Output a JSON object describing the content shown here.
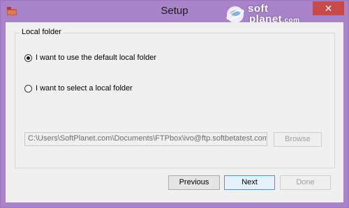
{
  "window": {
    "title": "Setup",
    "close_glyph": "✕"
  },
  "watermark": {
    "line1": "soft",
    "line2": "planet",
    "tld": ".com"
  },
  "local_folder": {
    "group_label": "Local folder",
    "options": [
      {
        "label": "I want to use the default local folder",
        "checked": true
      },
      {
        "label": "I want to select a local folder",
        "checked": false
      }
    ],
    "path_value": "C:\\Users\\SoftPlanet.com\\Documents\\FTPbox\\ivo@ftp.softbetatest.com",
    "browse_label": "Browse"
  },
  "buttons": {
    "previous": "Previous",
    "next": "Next",
    "done": "Done"
  },
  "colors": {
    "titlebar": "#a883ca",
    "client": "#f0f0f0",
    "close": "#c74a4a",
    "default_button_border": "#3399ff"
  }
}
